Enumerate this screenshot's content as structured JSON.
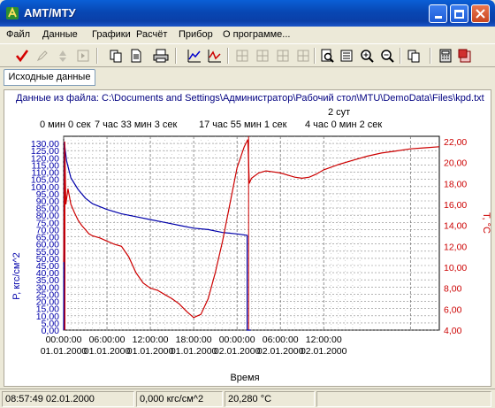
{
  "window": {
    "title": "АМТ/МТУ",
    "minimize_icon": "minimize-icon",
    "maximize_icon": "maximize-icon",
    "close_icon": "close-icon"
  },
  "menu": [
    "Файл",
    "Данные",
    "Графики",
    "Расчёт",
    "Прибор",
    "О программе..."
  ],
  "toolbar_icons": [
    "check-icon",
    "edit-icon",
    "recycle-icon",
    "next-icon",
    "copy-icon",
    "page-icon",
    "print-icon",
    "chart-icon",
    "chart-alt-icon",
    "grid-1-icon",
    "grid-2-icon",
    "grid-3-icon",
    "grid-4-icon",
    "zoom-page-icon",
    "list-icon",
    "zoom-in-icon",
    "zoom-out-icon",
    "pages-icon",
    "calculator-icon",
    "export-icon"
  ],
  "tabs": [
    "Исходные данные"
  ],
  "chart_header": {
    "file_label": "Данные из файла: C:\\Documents and Settings\\Администратор\\Рабочий стол\\MTU\\DemoData\\Files\\kpd.txt",
    "duration_total": "2 сут",
    "duration_marks": [
      "0 мин 0 сек",
      "7 час 33 мин 3 сек",
      "17 час 55 мин 1 сек",
      "4 час 0 мин 2 сек"
    ]
  },
  "chart_data": {
    "type": "line",
    "xlabel": "Время",
    "ylabel_left": "P, кгс/см^2",
    "ylabel_right": "T, °С",
    "ylim_left": [
      0,
      135
    ],
    "ylim_right": [
      4,
      22.5
    ],
    "x_unit": "hours from 01.01.2000 00:00",
    "xlim": [
      0,
      52
    ],
    "grid": true,
    "left_ticks": [
      "0,00",
      "5,00",
      "10,00",
      "15,00",
      "20,00",
      "25,00",
      "30,00",
      "35,00",
      "40,00",
      "45,00",
      "50,00",
      "55,00",
      "60,00",
      "65,00",
      "70,00",
      "75,00",
      "80,00",
      "85,00",
      "90,00",
      "95,00",
      "100,00",
      "105,00",
      "110,00",
      "115,00",
      "120,00",
      "125,00",
      "130,00"
    ],
    "right_ticks": [
      "4,00",
      "6,00",
      "8,00",
      "10,00",
      "12,00",
      "14,00",
      "16,00",
      "18,00",
      "20,00",
      "22,00"
    ],
    "x_ticks": [
      {
        "time": "00:00:00",
        "date": "01.01.2000"
      },
      {
        "time": "06:00:00",
        "date": "01.01.2000"
      },
      {
        "time": "12:00:00",
        "date": "01.01.2000"
      },
      {
        "time": "18:00:00",
        "date": "01.01.2000"
      },
      {
        "time": "00:00:00",
        "date": "02.01.2000"
      },
      {
        "time": "06:00:00",
        "date": "02.01.2000"
      },
      {
        "time": "12:00:00",
        "date": "02.01.2000"
      }
    ],
    "series": [
      {
        "name": "P",
        "axis": "left",
        "color": "#0000aa",
        "x": [
          0,
          0.08,
          0.4,
          1,
          2,
          3,
          4,
          6,
          8,
          10,
          12,
          14,
          16,
          18,
          20,
          22,
          24,
          25.4,
          25.4,
          25.9,
          25.9
        ],
        "y": [
          0,
          131,
          118,
          106,
          98,
          92,
          88,
          84,
          81,
          79,
          77,
          75,
          73,
          71,
          70,
          68,
          67,
          66,
          0,
          0,
          0
        ]
      },
      {
        "name": "T",
        "axis": "right",
        "color": "#cc0000",
        "x": [
          0,
          0.15,
          0.3,
          0.6,
          1,
          1.5,
          2,
          2.5,
          3,
          3.5,
          4,
          5,
          6,
          7,
          8,
          9,
          10,
          11,
          12,
          13,
          14,
          15,
          16,
          17,
          18,
          19,
          20,
          21,
          22,
          23,
          24,
          25,
          25.5,
          25.7,
          26,
          27,
          28,
          29,
          30,
          31,
          32,
          33,
          34,
          35,
          36,
          38,
          40,
          42,
          44,
          46,
          48,
          50,
          52
        ],
        "y": [
          10.5,
          22,
          16,
          17.5,
          16,
          15.2,
          14.5,
          14,
          13.6,
          13.2,
          13,
          12.8,
          12.5,
          12.2,
          12,
          11,
          9.5,
          8.5,
          8,
          7.8,
          7.4,
          7,
          6.5,
          5.8,
          5.2,
          5.5,
          7,
          9.5,
          12.5,
          16,
          19.5,
          21.5,
          22.2,
          18,
          18.5,
          19,
          19.2,
          19.1,
          19,
          18.8,
          18.6,
          18.5,
          18.6,
          18.9,
          19.3,
          19.8,
          20.2,
          20.6,
          20.9,
          21.1,
          21.3,
          21.4,
          21.5
        ]
      }
    ],
    "markers": [
      {
        "x": 25.6,
        "color": "#cc0000"
      }
    ]
  },
  "status": {
    "datetime": "08:57:49 02.01.2000",
    "pressure": "0,000 кгс/см^2",
    "temperature": "20,280 °C"
  }
}
